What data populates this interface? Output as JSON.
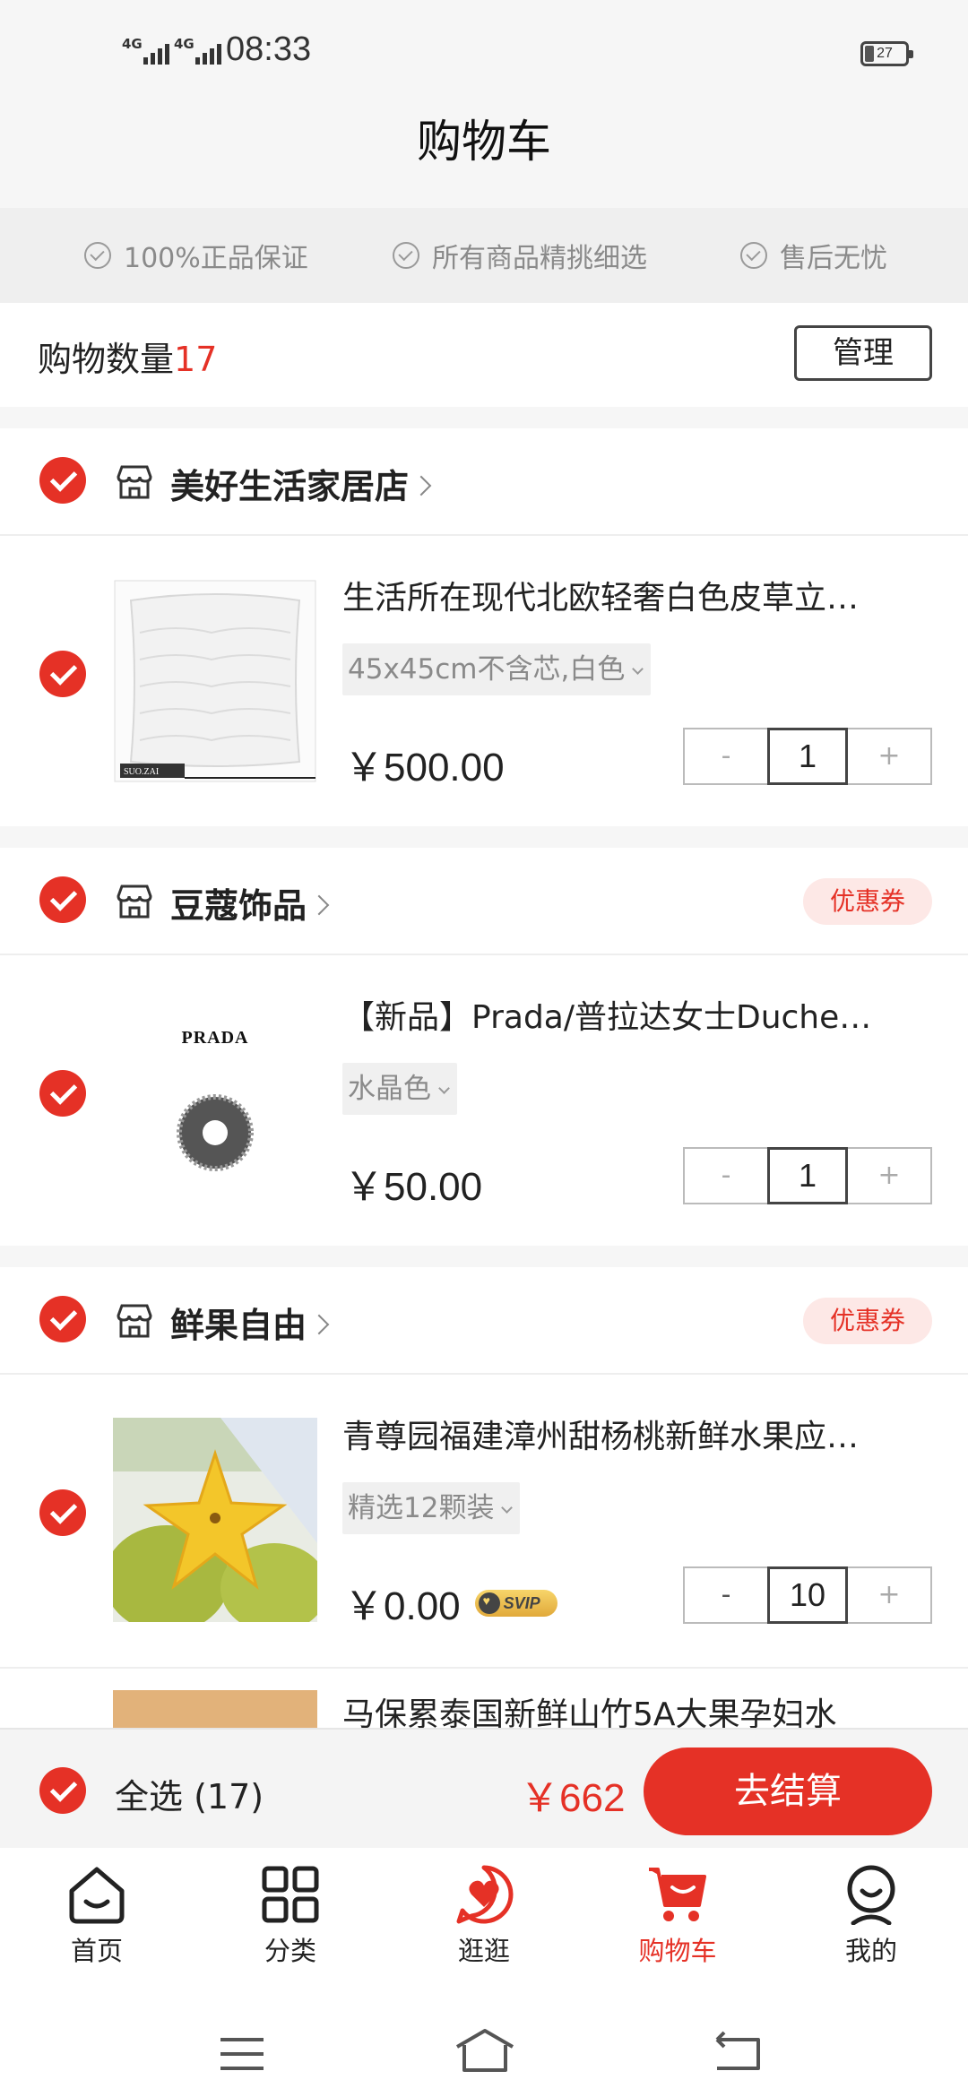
{
  "status_bar": {
    "network1": "4G",
    "network2": "4G",
    "time": "08:33",
    "battery": "27"
  },
  "page_title": "购物车",
  "guarantees": [
    "100%正品保证",
    "所有商品精挑细选",
    "售后无忧"
  ],
  "cart_count": {
    "label": "购物数量",
    "value": "17",
    "manage_label": "管理"
  },
  "stores": [
    {
      "name": "美好生活家居店",
      "coupon": "",
      "item": {
        "title": "生活所在现代北欧轻奢白色皮草立…",
        "spec": "45x45cm不含芯,白色",
        "price": "￥500.00",
        "qty": "1",
        "image_caption": "SUO.ZAI"
      }
    },
    {
      "name": "豆蔻饰品",
      "coupon": "优惠券",
      "item": {
        "title": "【新品】Prada/普拉达女士Duche…",
        "spec": "水晶色",
        "price": "￥50.00",
        "qty": "1",
        "image_caption": "PRADA"
      }
    },
    {
      "name": "鲜果自由",
      "coupon": "优惠券",
      "item": {
        "title": "青尊园福建漳州甜杨桃新鲜水果应…",
        "spec": "精选12颗装",
        "price": "￥0.00",
        "qty": "10",
        "badge": "SVIP"
      }
    }
  ],
  "partial_item_title": "马保累泰国新鲜山竹5A大果孕妇水",
  "checkout": {
    "select_all": "全选 (17)",
    "total": "￥662",
    "button": "去结算"
  },
  "tabs": [
    {
      "label": "首页",
      "icon": "home-icon"
    },
    {
      "label": "分类",
      "icon": "category-icon"
    },
    {
      "label": "逛逛",
      "icon": "browse-heart-icon"
    },
    {
      "label": "购物车",
      "icon": "cart-icon",
      "active": true
    },
    {
      "label": "我的",
      "icon": "profile-icon"
    }
  ],
  "colors": {
    "accent": "#e53126",
    "coupon_bg": "#fde8e6"
  }
}
